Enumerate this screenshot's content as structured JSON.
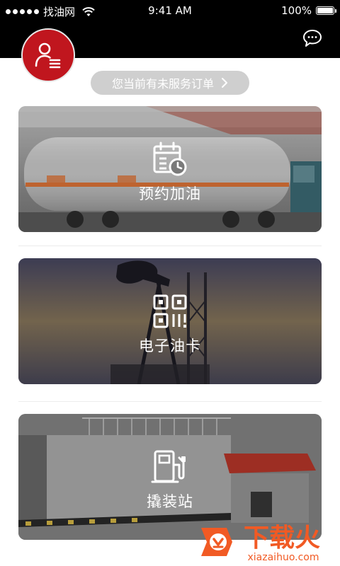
{
  "status_bar": {
    "carrier": "找油网",
    "time": "9:41 AM",
    "battery": "100%",
    "battery_level": 1.0
  },
  "header": {
    "avatar_icon": "user-menu-icon",
    "message_icon": "chat-bubble-icon"
  },
  "order_notice": {
    "label": "您当前有未服务订单",
    "icon": "chevron-right-icon"
  },
  "cards": [
    {
      "label": "预约加油",
      "icon": "calendar-clock-icon"
    },
    {
      "label": "电子油卡",
      "icon": "qr-code-icon"
    },
    {
      "label": "撬装站",
      "icon": "fuel-pump-icon"
    }
  ],
  "watermark": {
    "title": "下载火",
    "url": "xiazaihuo.com"
  },
  "colors": {
    "brand_red": "#c0161e",
    "header_bg": "#000000",
    "pill_bg": "#cfcfcf",
    "watermark_orange": "#f15a24"
  }
}
